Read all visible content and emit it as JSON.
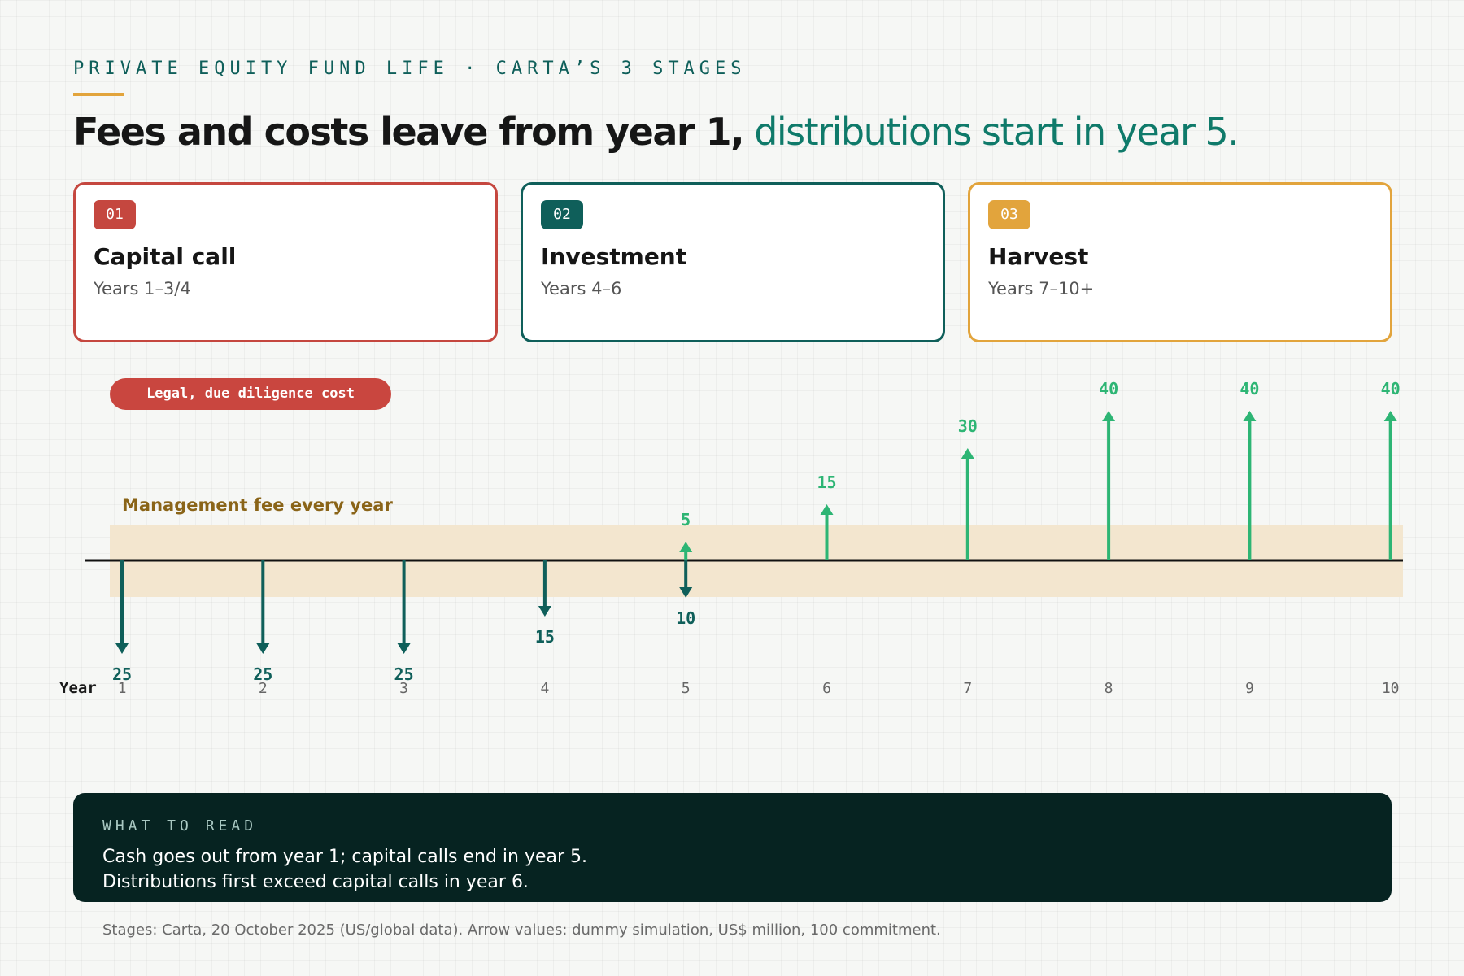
{
  "header": {
    "eyebrow": "PRIVATE EQUITY FUND LIFE · CARTA’S 3 STAGES",
    "headline_dark": "Fees and costs leave from year 1,",
    "headline_accent": "distributions start in year 5."
  },
  "stages": [
    {
      "num": "01",
      "name": "Capital call",
      "years": "Years 1–3/4",
      "color": "#c5473f"
    },
    {
      "num": "02",
      "name": "Investment",
      "years": "Years 4–6",
      "color": "#0f5f5a"
    },
    {
      "num": "03",
      "name": "Harvest",
      "years": "Years 7–10+",
      "color": "#e2a43c"
    }
  ],
  "annotations": {
    "legal_cost": "Legal, due diligence cost",
    "management_fee": "Management fee every year"
  },
  "chart_data": {
    "type": "bar",
    "xlabel": "Year",
    "categories": [
      "1",
      "2",
      "3",
      "4",
      "5",
      "6",
      "7",
      "8",
      "9",
      "10"
    ],
    "series": [
      {
        "values": [
          25,
          25,
          25,
          15,
          10,
          null,
          null,
          null,
          null,
          null
        ],
        "direction": "down",
        "color": "#0f5f5a"
      },
      {
        "values": [
          null,
          null,
          null,
          null,
          5,
          15,
          30,
          40,
          40,
          40
        ],
        "direction": "up",
        "color": "#2db574"
      }
    ],
    "axis_color": "#111111",
    "fee_band_color": "#f3e6cf"
  },
  "read": {
    "title": "WHAT TO READ",
    "line1": "Cash goes out from year 1; capital calls end in year 5.",
    "line2": "Distributions first exceed capital calls in year 6."
  },
  "source": "Stages: Carta, 20 October 2025 (US/global data). Arrow values: dummy simulation, US$ million, 100 commitment."
}
